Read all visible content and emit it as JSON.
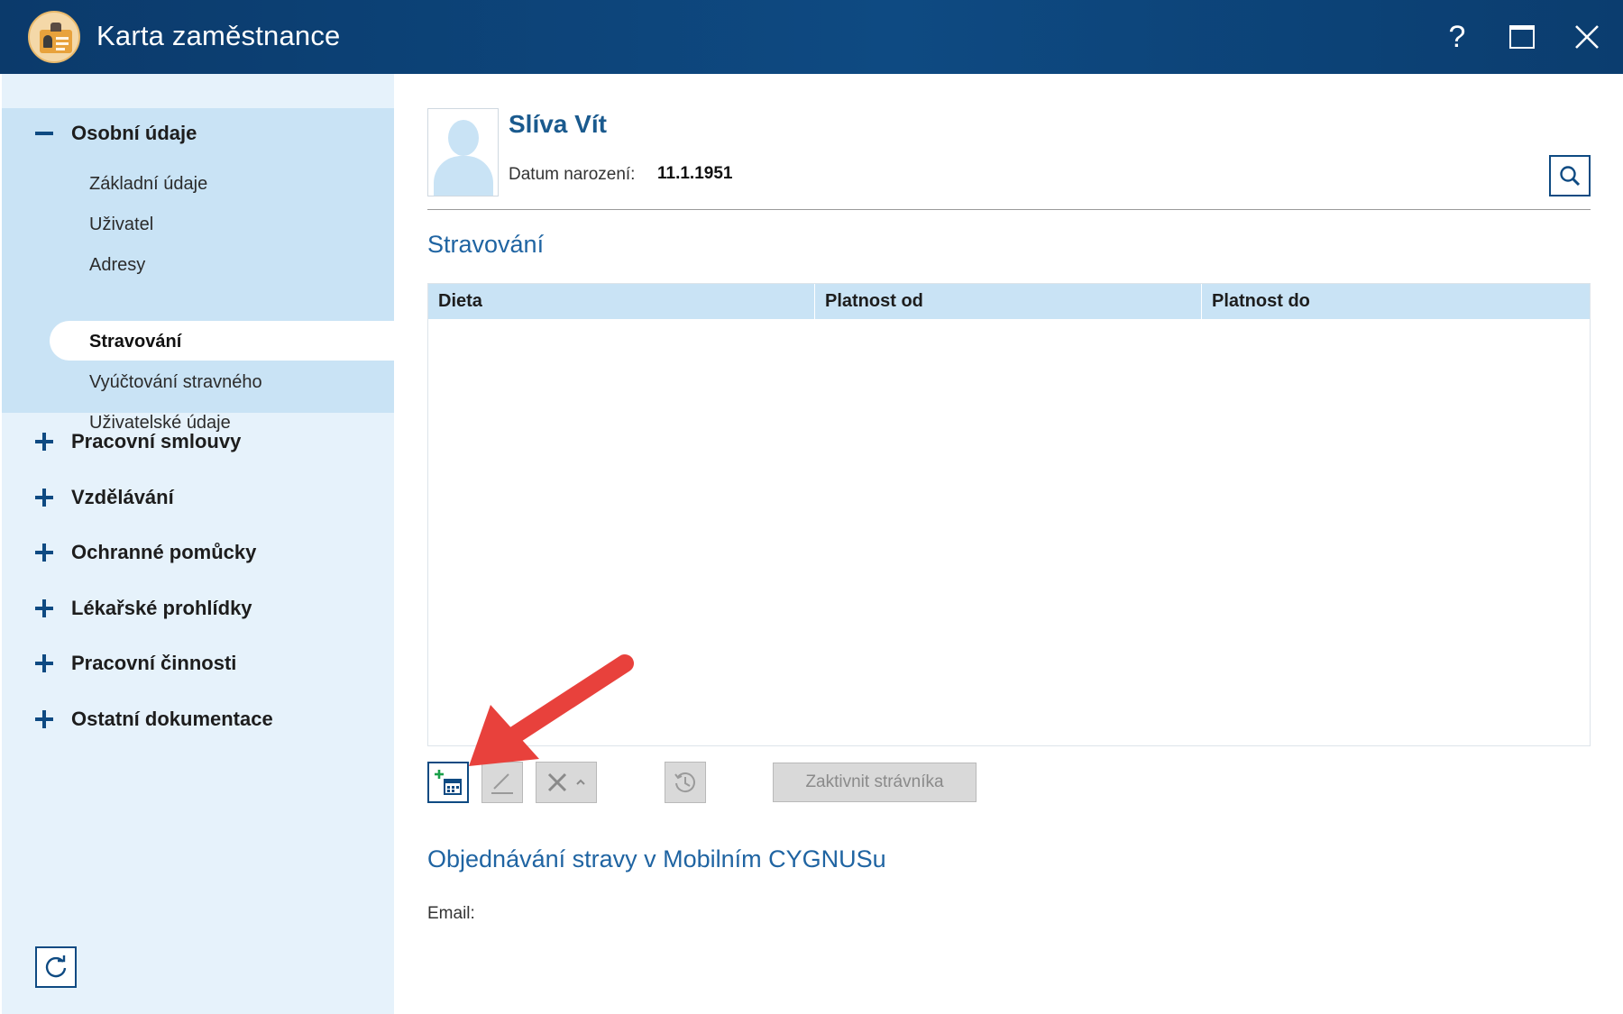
{
  "window": {
    "title": "Karta zaměstnance",
    "help_label": "?",
    "accent": "#0e4a82"
  },
  "sidebar": {
    "open_group": {
      "label": "Osobní údaje",
      "items": [
        {
          "label": "Základní údaje",
          "active": false
        },
        {
          "label": "Uživatel",
          "active": false
        },
        {
          "label": "Adresy",
          "active": false
        },
        {
          "label": "Stravování",
          "active": true
        },
        {
          "label": "Vyúčtování stravného",
          "active": false
        },
        {
          "label": "Uživatelské údaje",
          "active": false
        }
      ]
    },
    "groups": [
      {
        "label": "Pracovní smlouvy"
      },
      {
        "label": "Vzdělávání"
      },
      {
        "label": "Ochranné pomůcky"
      },
      {
        "label": "Lékařské prohlídky"
      },
      {
        "label": "Pracovní činnosti"
      },
      {
        "label": "Ostatní dokumentace"
      }
    ]
  },
  "person": {
    "name": "Slíva Vít",
    "dob_label": "Datum narození:",
    "dob_value": "11.1.1951"
  },
  "meals": {
    "title": "Stravování",
    "columns": [
      "Dieta",
      "Platnost od",
      "Platnost do"
    ],
    "rows": [],
    "activate_label": "Zaktivnit strávníka"
  },
  "mobile": {
    "title": "Objednávání stravy v Mobilním CYGNUSu",
    "email_label": "Email:"
  }
}
